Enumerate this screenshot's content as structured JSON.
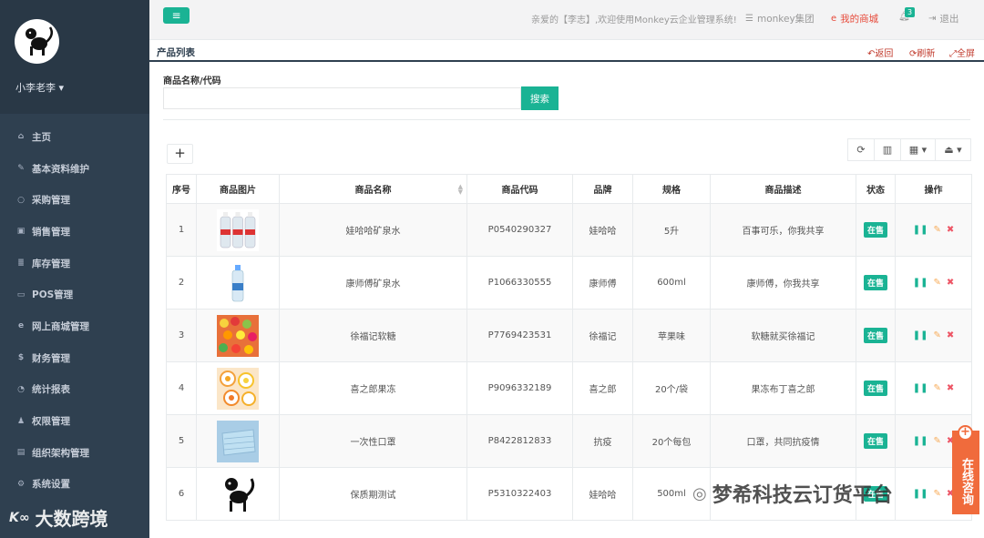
{
  "sidebar": {
    "username": "小李老李",
    "items": [
      {
        "icon": "home-icon",
        "glyph": "⌂",
        "label": "主页"
      },
      {
        "icon": "pencil-icon",
        "glyph": "✎",
        "label": "基本资料维护"
      },
      {
        "icon": "circle-icon",
        "glyph": "○",
        "label": "采购管理"
      },
      {
        "icon": "money-icon",
        "glyph": "▣",
        "label": "销售管理"
      },
      {
        "icon": "database-icon",
        "glyph": "≣",
        "label": "库存管理"
      },
      {
        "icon": "monitor-icon",
        "glyph": "▭",
        "label": "POS管理"
      },
      {
        "icon": "ie-icon",
        "glyph": "e",
        "label": "网上商城管理"
      },
      {
        "icon": "dollar-icon",
        "glyph": "$",
        "label": "财务管理"
      },
      {
        "icon": "pie-chart-icon",
        "glyph": "◔",
        "label": "统计报表"
      },
      {
        "icon": "user-icon",
        "glyph": "♟",
        "label": "权限管理"
      },
      {
        "icon": "org-icon",
        "glyph": "▤",
        "label": "组织架构管理"
      },
      {
        "icon": "gears-icon",
        "glyph": "⚙",
        "label": "系统设置"
      }
    ],
    "watermark": "大数跨境"
  },
  "topbar": {
    "welcome": "亲爱的【李志】,欢迎使用Monkey云企业管理系统!",
    "group": "monkey集团",
    "store": "我的商城",
    "badge": "3",
    "logout": "退出"
  },
  "tabstrip": {
    "title": "产品列表",
    "back": "返回",
    "refresh": "刷新",
    "fullscreen": "全屏"
  },
  "search": {
    "label": "商品名称/代码",
    "value": "",
    "button": "搜索"
  },
  "table": {
    "headers": [
      "序号",
      "商品图片",
      "商品名称",
      "商品代码",
      "品牌",
      "规格",
      "商品描述",
      "状态",
      "操作"
    ],
    "rows": [
      {
        "no": "1",
        "img": "water-bottles",
        "name": "娃哈哈矿泉水",
        "code": "P0540290327",
        "brand": "娃哈哈",
        "spec": "5升",
        "desc": "百事可乐，你我共享",
        "status": "在售"
      },
      {
        "no": "2",
        "img": "water-bottle",
        "name": "康师傅矿泉水",
        "code": "P1066330555",
        "brand": "康师傅",
        "spec": "600ml",
        "desc": "康师傅，你我共享",
        "status": "在售"
      },
      {
        "no": "3",
        "img": "candy",
        "name": "徐福记软糖",
        "code": "P7769423531",
        "brand": "徐福记",
        "spec": "苹果味",
        "desc": "软糖就买徐福记",
        "status": "在售"
      },
      {
        "no": "4",
        "img": "jelly",
        "name": "喜之郎果冻",
        "code": "P9096332189",
        "brand": "喜之郎",
        "spec": "20个/袋",
        "desc": "果冻布丁喜之郎",
        "status": "在售"
      },
      {
        "no": "5",
        "img": "mask",
        "name": "一次性口罩",
        "code": "P8422812833",
        "brand": "抗疫",
        "spec": "20个每包",
        "desc": "口罩，共同抗疫情",
        "status": "在售"
      },
      {
        "no": "6",
        "img": "monkey",
        "name": "保质期测试",
        "code": "P5310322403",
        "brand": "娃哈哈",
        "spec": "500ml",
        "desc": "",
        "status": "在售"
      }
    ]
  },
  "float": {
    "label": "在线咨询"
  },
  "watermark_right": "梦希科技云订货平台"
}
